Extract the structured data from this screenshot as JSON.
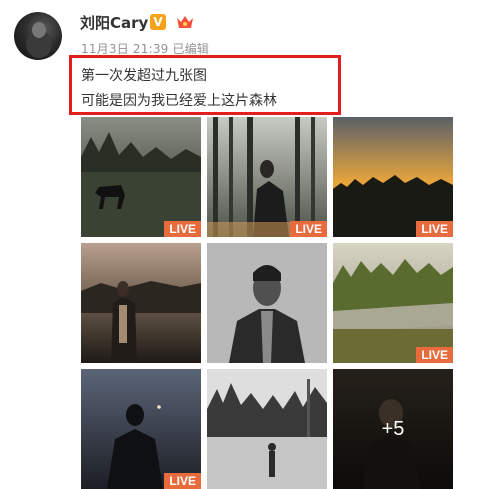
{
  "user": {
    "name": "刘阳Cary",
    "verified_badge": "V",
    "timestamp": "11月3日 21:39",
    "edited_label": "已编辑"
  },
  "post": {
    "line1": "第一次发超过九张图",
    "line2": "可能是因为我已经爱上这片森林"
  },
  "images": [
    {
      "live": "LIVE"
    },
    {
      "live": "LIVE"
    },
    {
      "live": "LIVE"
    },
    {
      "live": ""
    },
    {
      "live": ""
    },
    {
      "live": "LIVE"
    },
    {
      "live": "LIVE"
    },
    {
      "live": ""
    },
    {
      "live": "",
      "more": "+5"
    }
  ],
  "colors": {
    "highlight_border": "#e21e1e",
    "live_badge": "#e86b3d",
    "verified": "#f7a21b"
  }
}
